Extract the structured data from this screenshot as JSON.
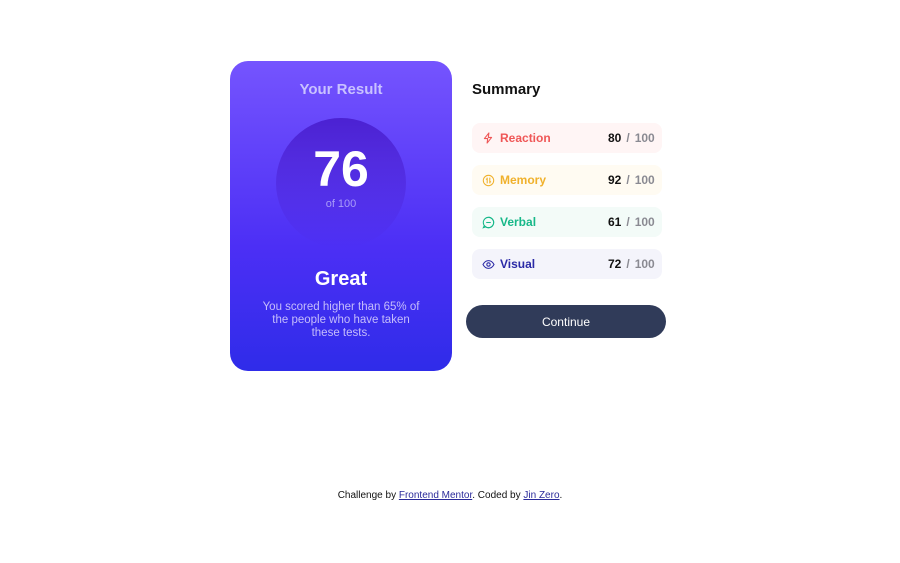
{
  "result": {
    "title": "Your Result",
    "score": "76",
    "score_of": "of 100",
    "grade": "Great",
    "description": "You scored higher than 65% of the people who have taken these tests."
  },
  "summary": {
    "title": "Summary",
    "items": [
      {
        "label": "Reaction",
        "score": "80",
        "separator": "/",
        "max": "100",
        "icon": "lightning-icon",
        "color": "#ef5757",
        "bg": "#fff5f5"
      },
      {
        "label": "Memory",
        "score": "92",
        "separator": "/",
        "max": "100",
        "icon": "brain-icon",
        "color": "#f0b12c",
        "bg": "#fffbf2"
      },
      {
        "label": "Verbal",
        "score": "61",
        "separator": "/",
        "max": "100",
        "icon": "chat-bubble-icon",
        "color": "#17b889",
        "bg": "#f3fbf8"
      },
      {
        "label": "Visual",
        "score": "72",
        "separator": "/",
        "max": "100",
        "icon": "eye-icon",
        "color": "#2a29a6",
        "bg": "#f4f4fb"
      }
    ],
    "continue_label": "Continue"
  },
  "footer": {
    "prefix": "Challenge by ",
    "link1": "Frontend Mentor",
    "middle": ". Coded by ",
    "link2": "Jin Zero",
    "suffix": "."
  }
}
